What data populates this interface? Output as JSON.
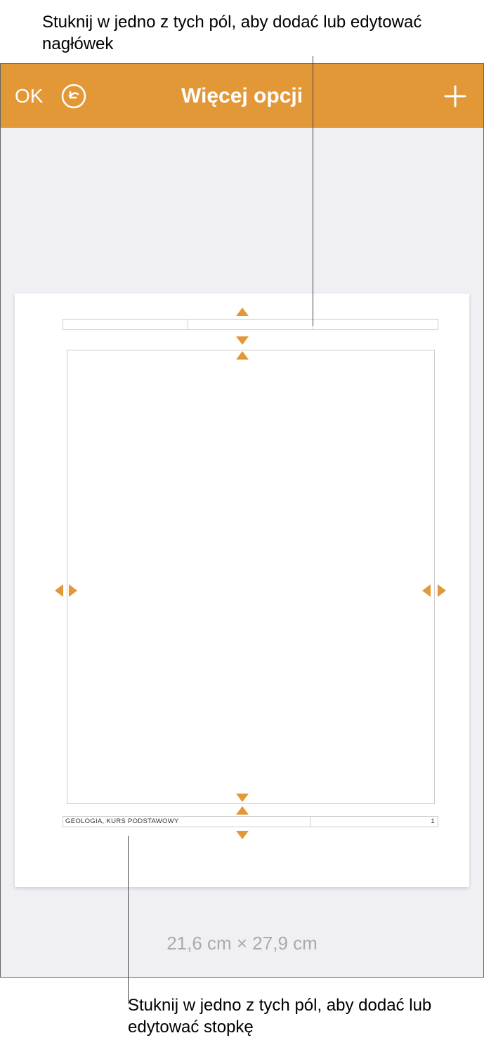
{
  "callouts": {
    "top": "Stuknij w jedno z tych pól, aby dodać lub edytować nagłówek",
    "bottom": "Stuknij w jedno z tych pól, aby dodać lub edytować stopkę"
  },
  "toolbar": {
    "ok_label": "OK",
    "title": "Więcej opcji"
  },
  "footer": {
    "text": "GEOLOGIA, KURS PODSTAWOWY",
    "page_number": "1"
  },
  "dimensions": "21,6 cm × 27,9 cm"
}
